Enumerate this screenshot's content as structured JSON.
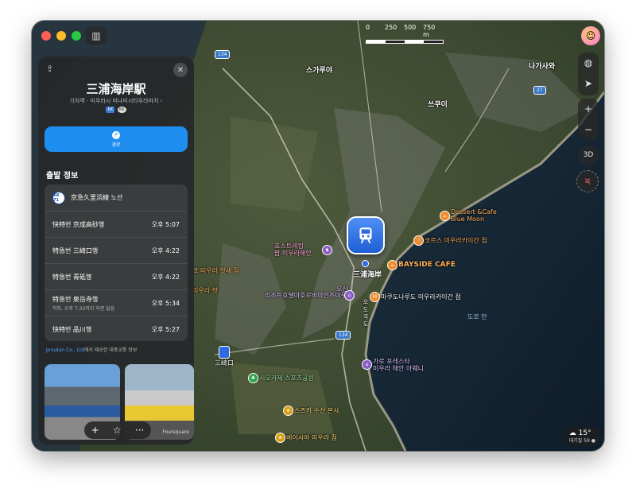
{
  "window": {
    "app": "Maps"
  },
  "scale": {
    "labels": [
      "0",
      "250",
      "500",
      "750 m"
    ]
  },
  "map_labels": {
    "skagaya": "스가루야",
    "nagasawa": "나가사와",
    "tsukui": "쓰쿠이",
    "dossert": "Dossert &Cafe",
    "blue_moon": "Blue Moon",
    "corsus": "코르스 미우라카이간 점",
    "bayside": "BAYSIDE CAFE",
    "horse_trekking1": "호스트레킹",
    "horse_trekking2": "팜 미우라해안",
    "station_label": "三浦海岸",
    "resort": "리조트호텔마호로바마인즈미우라",
    "oshin": "오신",
    "marudonald": "마쿠도나루도 미우라카이간 점",
    "dorodan": "도로 만",
    "misaki_left1": "코 미우라 핫세 점",
    "misaki_left2": "미우라 핫",
    "sankou": "三崎口",
    "shio": "시오카제 스포츠공원",
    "karo1": "가로 포레스타",
    "karo2": "미우라 해안 아웨니",
    "suzuki": "스즈키 수산 본사",
    "beisia": "베이시아 미우라 점",
    "route134a": "134",
    "route134b": "134",
    "route27": "27",
    "route_vert": "오 도 국 도"
  },
  "controls": {
    "threeD": "3D",
    "compass": "북",
    "zoom_in": "+",
    "zoom_out": "−"
  },
  "weather": {
    "temp": "☁ 15°",
    "aqi": "대기질 59 ●"
  },
  "panel": {
    "title": "三浦海岸駅",
    "subtitle": "기차역 · 미우라시 미나미시타우라마치 ›",
    "badges": [
      "KK",
      "KK"
    ],
    "route_button": "경로",
    "section_title": "출발 정보",
    "line_badge": "KK 71",
    "line_name": "京急久里浜線 노선",
    "departures": [
      {
        "dest": "快特번 京成高砂행",
        "note": "",
        "time": "오후 5:07"
      },
      {
        "dest": "特急번 三崎口행",
        "note": "",
        "time": "오후 4:22"
      },
      {
        "dest": "特急번 青砥행",
        "note": "",
        "time": "오후 4:22"
      },
      {
        "dest": "特急번 泉岳寺행",
        "note": "막차, 오후 7:33까지 자련 없음",
        "time": "오후 5:34"
      },
      {
        "dest": "快特번 品川행",
        "note": "",
        "time": "오후 5:27"
      }
    ],
    "attribution_link": "Jorudan Co., Ltd",
    "attribution_rest": "에서 제공한 대중교통 정보",
    "photo_credit": "Foursquare",
    "toolbar": {
      "add": "+",
      "star": "☆",
      "more": "···"
    }
  }
}
